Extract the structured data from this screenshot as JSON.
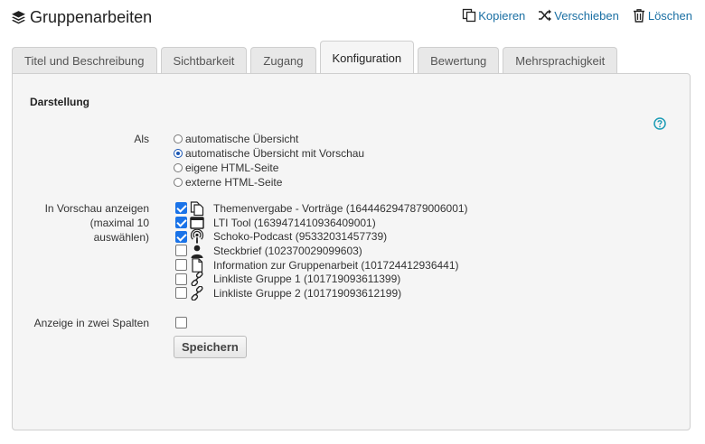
{
  "header": {
    "title": "Gruppenarbeiten",
    "title_icon": "layers-icon",
    "actions": [
      {
        "label": "Kopieren",
        "icon": "copy-icon"
      },
      {
        "label": "Verschieben",
        "icon": "shuffle-icon"
      },
      {
        "label": "Löschen",
        "icon": "trash-icon"
      }
    ]
  },
  "tabs": [
    {
      "label": "Titel und Beschreibung",
      "active": false
    },
    {
      "label": "Sichtbarkeit",
      "active": false
    },
    {
      "label": "Zugang",
      "active": false
    },
    {
      "label": "Konfiguration",
      "active": true
    },
    {
      "label": "Bewertung",
      "active": false
    },
    {
      "label": "Mehrsprachigkeit",
      "active": false
    }
  ],
  "panel": {
    "section_title": "Darstellung",
    "help_icon": "help-icon",
    "als": {
      "label": "Als",
      "options": [
        {
          "label": "automatische Übersicht",
          "checked": false
        },
        {
          "label": "automatische Übersicht mit Vorschau",
          "checked": true
        },
        {
          "label": "eigene HTML-Seite",
          "checked": false
        },
        {
          "label": "externe HTML-Seite",
          "checked": false
        }
      ]
    },
    "preview": {
      "label_line1": "In Vorschau anzeigen",
      "label_line2": "(maximal 10",
      "label_line3": "auswählen)",
      "items": [
        {
          "label": "Themenvergabe - Vorträge (1644462947879006001)",
          "checked": true,
          "icon": "copy-pages-icon"
        },
        {
          "label": "LTI Tool (1639471410936409001)",
          "checked": true,
          "icon": "window-icon"
        },
        {
          "label": "Schoko-Podcast (95332031457739)",
          "checked": true,
          "icon": "podcast-icon"
        },
        {
          "label": "Steckbrief (102370029099603)",
          "checked": false,
          "icon": "person-icon"
        },
        {
          "label": "Information zur Gruppenarbeit (101724412936441)",
          "checked": false,
          "icon": "page-icon"
        },
        {
          "label": "Linkliste Gruppe 1 (101719093611399)",
          "checked": false,
          "icon": "link-icon"
        },
        {
          "label": "Linkliste Gruppe 2 (101719093612199)",
          "checked": false,
          "icon": "link-icon"
        }
      ]
    },
    "two_columns": {
      "label": "Anzeige in zwei Spalten",
      "checked": false
    },
    "save_label": "Speichern"
  }
}
